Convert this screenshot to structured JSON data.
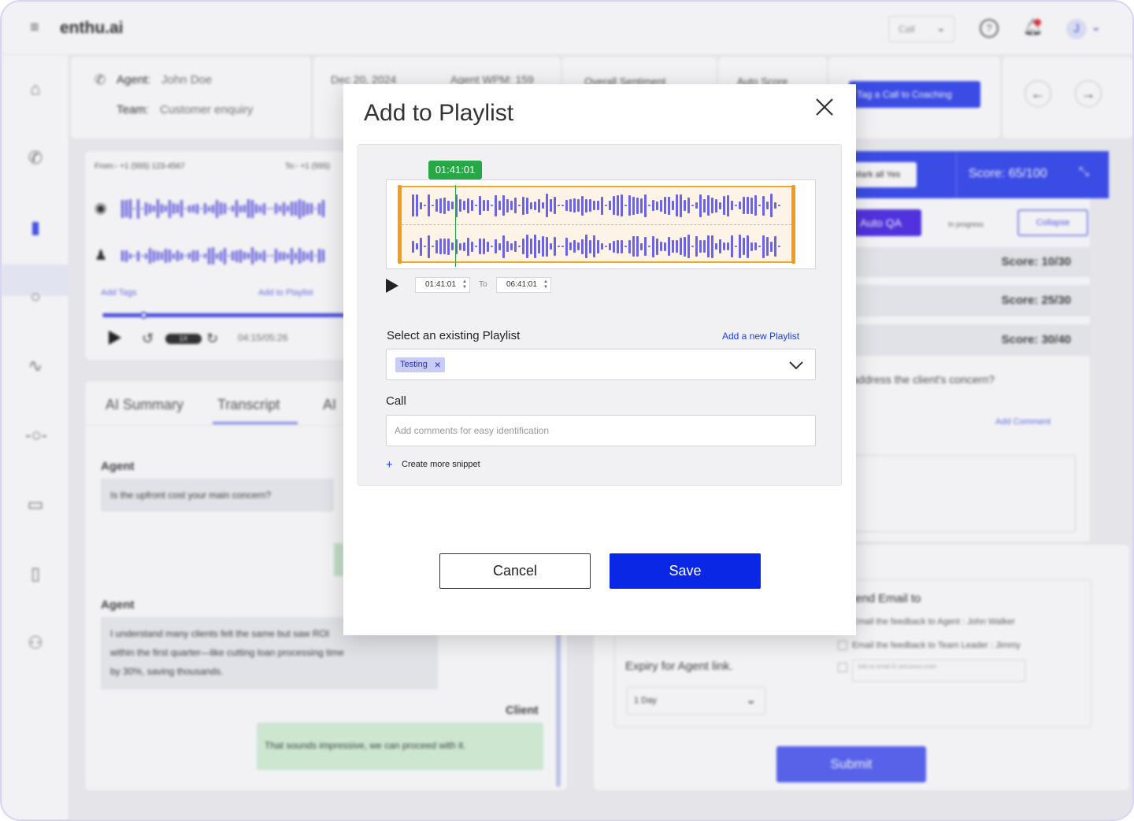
{
  "app": {
    "logo": "enthu.ai",
    "call_select": "Call",
    "avatar_initial": "J"
  },
  "header": {
    "agent_label": "Agent:",
    "agent_name": "John Doe",
    "team_label": "Team:",
    "team_name": "Customer enquiry",
    "date": "Dec 20, 2024",
    "agent_wpm": "Agent WPM: 159",
    "overall_sentiment": "Overall Sentiment",
    "auto_score": "Auto Score",
    "tag_button": "Tag a Call to Coaching"
  },
  "player": {
    "from": "From:- +1 (555) 123-4567",
    "to": "To:- +1 (555)",
    "add_tags": "Add Tags",
    "add_to_playlist": "Add to Playlist",
    "speed": "1X",
    "time": "04:15/05:26"
  },
  "transcript_tabs": [
    "AI Summary",
    "Transcript",
    "AI"
  ],
  "transcript": {
    "agent_label_1": "Agent",
    "agent_msg_1": "Is the upfront cost your main concern?",
    "agent_label_2": "Agent",
    "agent_msg_2a": "I understand many clients felt the same but saw ROI",
    "agent_msg_2b": "within the first quarter—like cutting loan processing time",
    "agent_msg_2c": "by 30%, saving thousands.",
    "client_label": "Client",
    "client_msg": "That sounds impressive, we can proceed with it."
  },
  "scorecard": {
    "mark_all_yes": "Mark all Yes",
    "total_score": "Score: 65/100",
    "auto_qa": "Auto QA",
    "in_progress": "In progress",
    "collapse": "Collapse",
    "score_1": "Score: 10/30",
    "score_2": "Score: 25/30",
    "score_3": "Score: 30/40",
    "question": "address the client's concern?",
    "add_comment": "Add Comment",
    "send_email_to": "Send Email to",
    "email_agent": "Email the feedback to Agent : John Walker",
    "email_leader": "Email the feedback to Team Leader : Jimmy",
    "email_placeholder": "Add an email ID and press enter",
    "expiry_label": "Expiry for Agent link.",
    "expiry_value": "1 Day",
    "submit": "Submit"
  },
  "modal": {
    "title": "Add to Playlist",
    "timestamp": "01:41:01",
    "start_time": "01:41:01",
    "to_label": "To",
    "end_time": "06:41:01",
    "select_label": "Select an existing Playlist",
    "add_new_link": "Add a new Playlist",
    "selected_playlist": "Testing",
    "call_label": "Call",
    "comment_placeholder": "Add comments for easy identification",
    "create_more": "Create more snippet",
    "cancel": "Cancel",
    "save": "Save"
  },
  "colors": {
    "accent": "#0a27e6",
    "waveform": "#6b63e6",
    "selection": "#f5a623",
    "timestamp_badge": "#27a745"
  }
}
